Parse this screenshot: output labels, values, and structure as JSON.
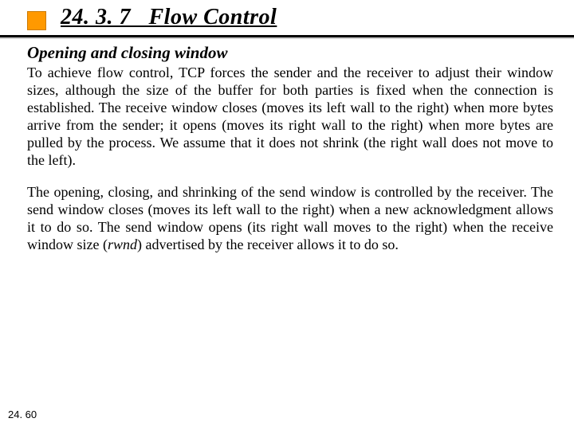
{
  "header": {
    "section_number": "24. 3. 7",
    "section_title": "Flow Control"
  },
  "content": {
    "subheading": "Opening and closing window",
    "para1": "To achieve flow control, TCP forces the sender and the receiver to adjust their window sizes, although the size of the buffer for both parties is fixed when the connection is established. The receive window closes (moves its left wall to the right) when more bytes arrive from the sender; it opens (moves its right wall to the right) when more bytes are pulled by the process. We assume that it does not shrink (the right wall does not move to the left).",
    "para2_a": "The opening, closing, and shrinking of the send window is controlled by the receiver. The send window closes (moves its left wall to the right) when a new acknowledgment allows it to do so. The send window opens (its right wall moves to the right) when the receive window size (",
    "para2_rwnd": "rwnd",
    "para2_b": ") advertised by the receiver allows it to do so."
  },
  "footer": {
    "page_number": "24. 60"
  }
}
